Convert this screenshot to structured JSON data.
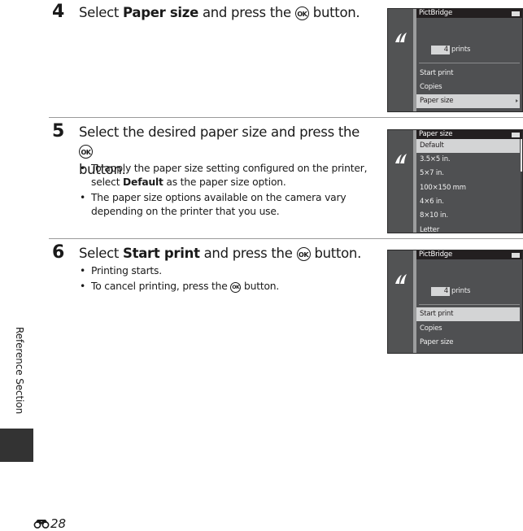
{
  "steps": [
    {
      "number": "4",
      "title_parts": [
        "Select ",
        "Paper size",
        " and press the ",
        "OK",
        " button."
      ],
      "bullets": []
    },
    {
      "number": "5",
      "title_parts": [
        "Select the desired paper size and press the ",
        "OK",
        " button."
      ],
      "bullets": [
        {
          "parts": [
            "To apply the paper size setting configured on the printer, select ",
            "Default",
            " as the paper size option."
          ]
        },
        {
          "parts": [
            "The paper size options available on the camera vary depending on the printer that you use."
          ]
        }
      ]
    },
    {
      "number": "6",
      "title_parts": [
        "Select ",
        "Start print",
        " and press the ",
        "OK",
        " button."
      ],
      "bullets": [
        {
          "parts": [
            "Printing starts."
          ]
        },
        {
          "parts": [
            "To cancel printing, press the ",
            "OK",
            " button."
          ]
        }
      ]
    }
  ],
  "screens": [
    {
      "title": "PictBridge",
      "icon": "pictbridge-icon",
      "prints_count": "4",
      "prints_label": "prints",
      "menu": [
        {
          "label": "Start print",
          "selected": false
        },
        {
          "label": "Copies",
          "selected": false
        },
        {
          "label": "Paper size",
          "selected": true
        }
      ]
    },
    {
      "title": "Paper size",
      "icon": "pictbridge-icon",
      "options": [
        {
          "label": "Default",
          "selected": true
        },
        {
          "label": "3.5×5 in.",
          "selected": false
        },
        {
          "label": "5×7 in.",
          "selected": false
        },
        {
          "label": "100×150 mm",
          "selected": false
        },
        {
          "label": "4×6 in.",
          "selected": false
        },
        {
          "label": "8×10 in.",
          "selected": false
        },
        {
          "label": "Letter",
          "selected": false
        }
      ]
    },
    {
      "title": "PictBridge",
      "icon": "pictbridge-icon",
      "prints_count": "4",
      "prints_label": "prints",
      "menu": [
        {
          "label": "Start print",
          "selected": true
        },
        {
          "label": "Copies",
          "selected": false
        },
        {
          "label": "Paper size",
          "selected": false
        }
      ]
    }
  ],
  "ok_button_glyph": "OK",
  "side_section_label": "Reference Section",
  "page_number": "28",
  "page_prefix_icon": "reference-section-icon"
}
